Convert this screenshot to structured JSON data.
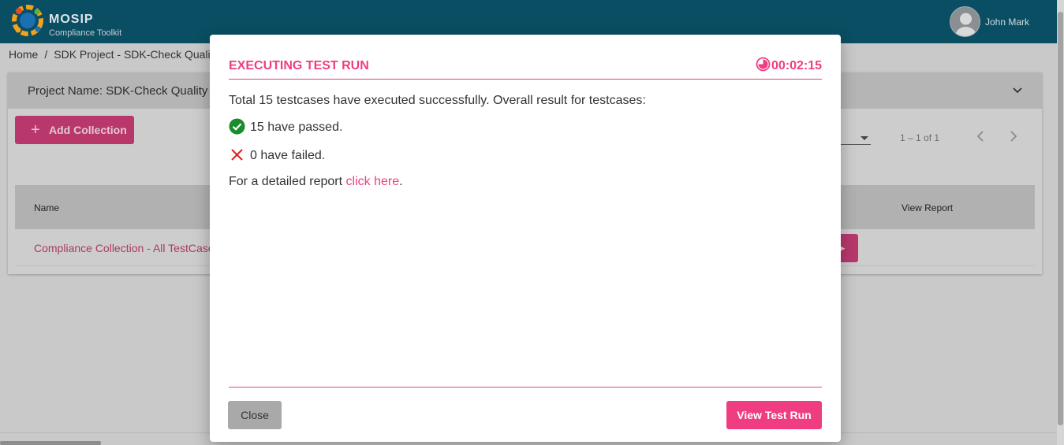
{
  "header": {
    "brand_title": "MOSIP",
    "brand_subtitle": "Compliance Toolkit",
    "user_name": "John Mark",
    "logo_icon": "mosip-logo",
    "avatar_icon": "user-avatar-icon"
  },
  "breadcrumb": {
    "items": [
      "Home",
      "SDK Project - SDK-Check Quality"
    ],
    "separator": "/"
  },
  "project": {
    "title": "Project Name: SDK-Check Quality",
    "add_collection_label": "Add Collection",
    "pagination_range": "1 – 1 of 1",
    "table": {
      "columns": [
        "Name",
        "View Report"
      ],
      "rows": [
        {
          "name": "Compliance Collection - All TestCase"
        }
      ]
    }
  },
  "modal": {
    "title": "EXECUTING TEST RUN",
    "timer": "00:02:15",
    "summary": "Total 15 testcases have executed successfully. Overall result for testcases:",
    "passed_text": "15 have passed.",
    "failed_text": "0 have failed.",
    "report_prefix": "For a detailed report ",
    "report_link": "click here",
    "report_suffix": ".",
    "close_label": "Close",
    "view_label": "View Test Run"
  },
  "colors": {
    "accent": "#f03d82",
    "header_bg": "#0a4e63",
    "pass": "#1a8c2e",
    "fail": "#e02020"
  }
}
